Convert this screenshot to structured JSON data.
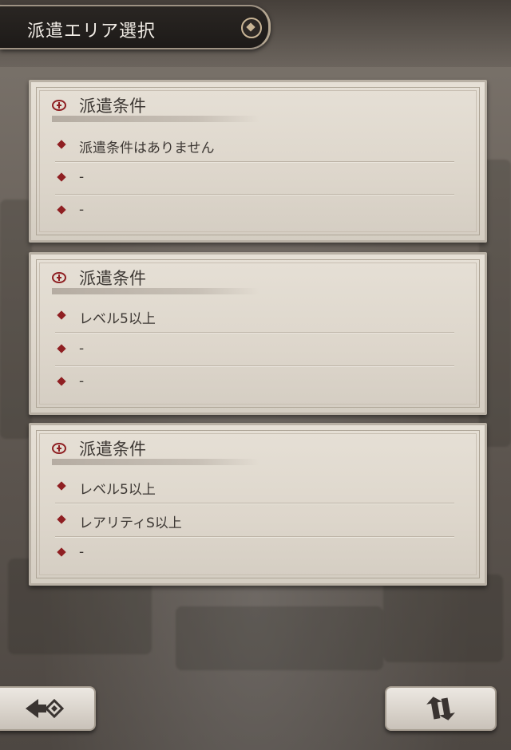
{
  "header": {
    "title": "派遣エリア選択"
  },
  "panels": [
    {
      "title": "派遣条件",
      "conditions": [
        "派遣条件はありません",
        "-",
        "-"
      ]
    },
    {
      "title": "派遣条件",
      "conditions": [
        "レベル5以上",
        "-",
        "-"
      ]
    },
    {
      "title": "派遣条件",
      "conditions": [
        "レベル5以上",
        "レアリティS以上",
        "-"
      ]
    }
  ],
  "footer": {
    "back_icon": "back-arrow-icon",
    "refresh_icon": "refresh-icon"
  },
  "colors": {
    "accent": "#8f1f22",
    "panel_bg": "#e6e0d6",
    "header_bg": "#1d1a18"
  }
}
